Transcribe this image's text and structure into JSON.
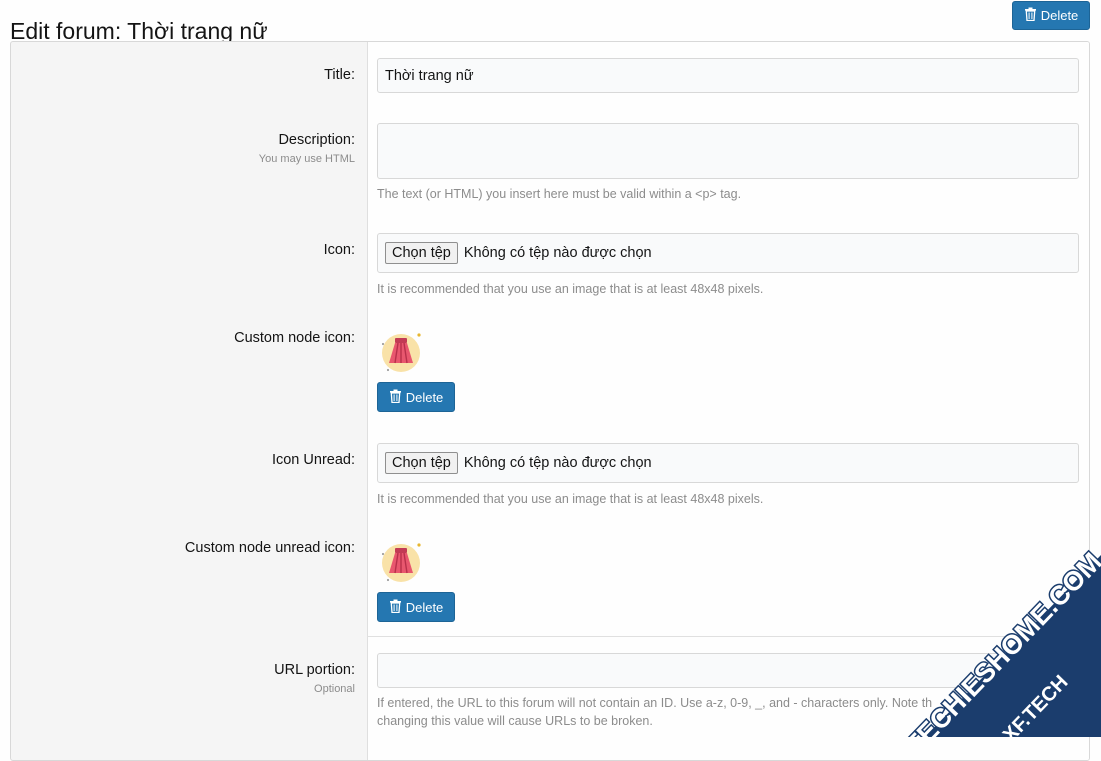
{
  "header": {
    "title": "Edit forum: Thời trang nữ",
    "delete_label": "Delete"
  },
  "form": {
    "title": {
      "label": "Title:",
      "value": "Thời trang nữ"
    },
    "description": {
      "label": "Description:",
      "sublabel": "You may use HTML",
      "value": "",
      "hint": "The text (or HTML) you insert here must be valid within a <p> tag."
    },
    "icon": {
      "label": "Icon:",
      "button": "Chọn tệp",
      "file_status": "Không có tệp nào được chọn",
      "hint": "It is recommended that you use an image that is at least 48x48 pixels."
    },
    "custom_icon": {
      "label": "Custom node icon:",
      "delete_label": "Delete"
    },
    "icon_unread": {
      "label": "Icon Unread:",
      "button": "Chọn tệp",
      "file_status": "Không có tệp nào được chọn",
      "hint": "It is recommended that you use an image that is at least 48x48 pixels."
    },
    "custom_unread_icon": {
      "label": "Custom node unread icon:",
      "delete_label": "Delete"
    },
    "url_portion": {
      "label": "URL portion:",
      "sublabel": "Optional",
      "value": "",
      "hint_line1": "If entered, the URL to this forum will not contain an ID. Use a-z, 0-9, _, and - characters only. Note th",
      "hint_line1_tail": "pecifi",
      "hint_line2": "changing this value will cause URLs to be broken."
    }
  },
  "watermark": {
    "line1": "TECHIESHOME.COM",
    "line2": "XF.TECH"
  },
  "colors": {
    "primary_button": "#2577b1",
    "label_panel": "#f5f5f5",
    "watermark_blue": "#1b3d6d",
    "watermark_orange": "#f5a623"
  }
}
